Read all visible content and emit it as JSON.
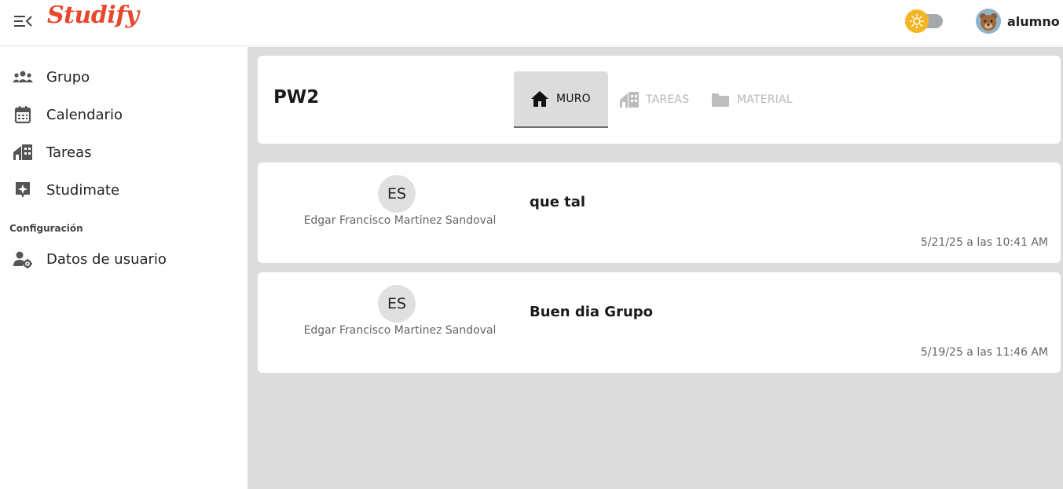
{
  "header": {
    "logo": "Studify",
    "user_name": "alumno",
    "menu_icon": "menu-collapse-icon",
    "theme_toggle_icon": "sun-icon"
  },
  "sidebar": {
    "items": [
      {
        "label": "Grupo",
        "icon": "group-icon"
      },
      {
        "label": "Calendario",
        "icon": "calendar-icon"
      },
      {
        "label": "Tareas",
        "icon": "tasks-icon"
      },
      {
        "label": "Studimate",
        "icon": "sparkle-icon"
      }
    ],
    "section_label": "Configuración",
    "config_items": [
      {
        "label": "Datos de usuario",
        "icon": "user-settings-icon"
      }
    ]
  },
  "course": {
    "title": "PW2",
    "tabs": [
      {
        "label": "MURO",
        "icon": "home-icon",
        "active": true
      },
      {
        "label": "TAREAS",
        "icon": "tasks-icon",
        "active": false
      },
      {
        "label": "MATERIAL",
        "icon": "folder-icon",
        "active": false
      }
    ]
  },
  "posts": [
    {
      "initials": "ES",
      "author": "Edgar Francisco Martinez Sandoval",
      "text": "que tal",
      "time": "5/21/25 a las 10:41 AM"
    },
    {
      "initials": "ES",
      "author": "Edgar Francisco Martinez Sandoval",
      "text": "Buen dia Grupo",
      "time": "5/19/25 a las 11:46 AM"
    }
  ],
  "colors": {
    "brand": "#e8472e",
    "sun": "#f5b625",
    "main_bg": "#dcdcdc"
  }
}
